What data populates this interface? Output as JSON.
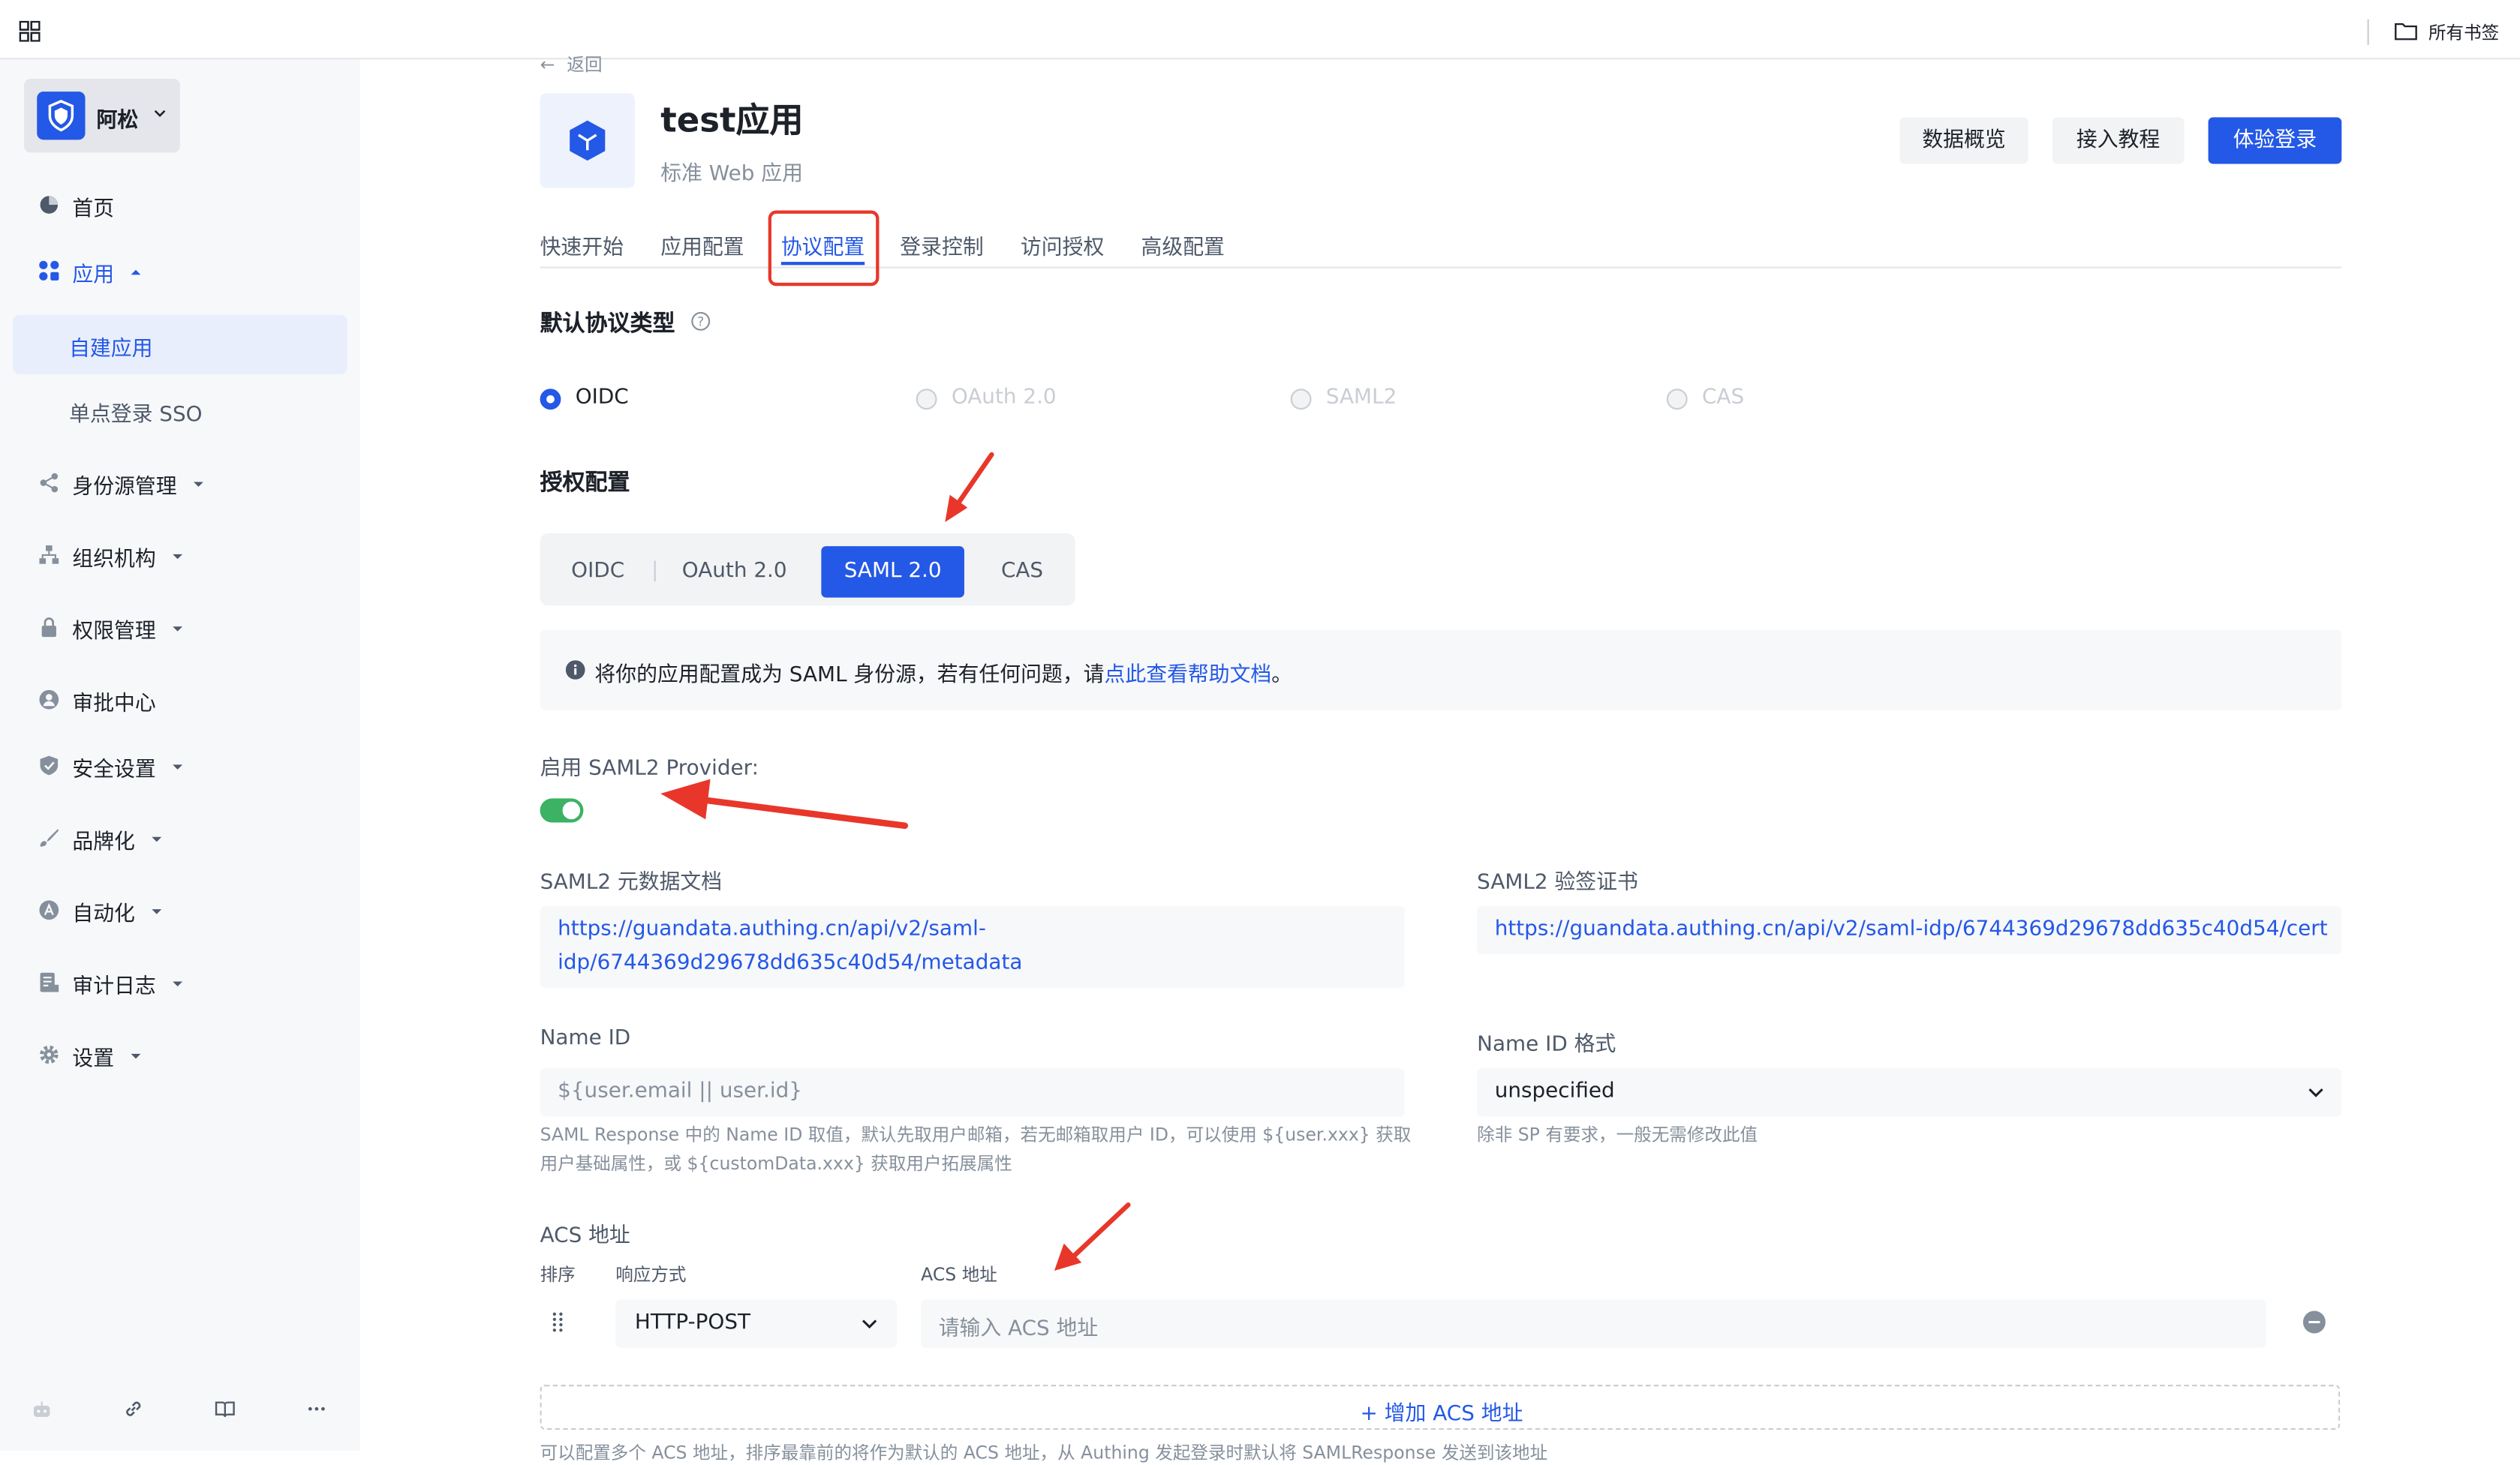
{
  "topbar": {
    "bookmarks_label": "所有书签"
  },
  "sidebar": {
    "org_name": "阿松",
    "nav": [
      {
        "label": "首页"
      },
      {
        "label": "应用"
      },
      {
        "label": "身份源管理"
      },
      {
        "label": "组织机构"
      },
      {
        "label": "权限管理"
      },
      {
        "label": "审批中心"
      },
      {
        "label": "安全设置"
      },
      {
        "label": "品牌化"
      },
      {
        "label": "自动化"
      },
      {
        "label": "审计日志"
      },
      {
        "label": "设置"
      }
    ],
    "app_sub": [
      {
        "label": "自建应用"
      },
      {
        "label": "单点登录 SSO"
      }
    ]
  },
  "header": {
    "back_label": "返回",
    "app_name": "test应用",
    "app_type": "标准 Web 应用",
    "btn_overview": "数据概览",
    "btn_tutorial": "接入教程",
    "btn_try_login": "体验登录"
  },
  "tabs": [
    {
      "label": "快速开始"
    },
    {
      "label": "应用配置"
    },
    {
      "label": "协议配置"
    },
    {
      "label": "登录控制"
    },
    {
      "label": "访问授权"
    },
    {
      "label": "高级配置"
    }
  ],
  "default_protocol": {
    "title": "默认协议类型",
    "options": [
      {
        "label": "OIDC",
        "selected": true
      },
      {
        "label": "OAuth 2.0",
        "selected": false
      },
      {
        "label": "SAML2",
        "selected": false
      },
      {
        "label": "CAS",
        "selected": false
      }
    ]
  },
  "auth_config": {
    "title": "授权配置",
    "segments": [
      {
        "label": "OIDC"
      },
      {
        "label": "OAuth 2.0"
      },
      {
        "label": "SAML 2.0"
      },
      {
        "label": "CAS"
      }
    ],
    "selected": "SAML 2.0"
  },
  "info": {
    "text": "将你的应用配置成为 SAML 身份源，若有任何问题，请",
    "link": "点此查看帮助文档",
    "suffix": "。"
  },
  "saml": {
    "enable_label": "启用 SAML2 Provider:",
    "enabled": true,
    "metadata_label": "SAML2 元数据文档",
    "metadata_line1": "https://guandata.authing.cn/api/v2/saml-",
    "metadata_line2": "idp/6744369d29678dd635c40d54/metadata",
    "cert_label": "SAML2 验签证书",
    "cert_url": "https://guandata.authing.cn/api/v2/saml-idp/6744369d29678dd635c40d54/cert",
    "nameid_label": "Name ID",
    "nameid_placeholder": "${user.email || user.id}",
    "nameid_hint1": "SAML Response 中的 Name ID 取值，默认先取用户邮箱，若无邮箱取用户 ID，可以使用 ${user.xxx} 获取",
    "nameid_hint2": "用户基础属性，或 ${customData.xxx} 获取用户拓展属性",
    "nameid_format_label": "Name ID 格式",
    "nameid_format_value": "unspecified",
    "nameid_format_hint": "除非 SP 有要求，一般无需修改此值"
  },
  "acs": {
    "title": "ACS 地址",
    "col_order": "排序",
    "col_method": "响应方式",
    "col_url": "ACS 地址",
    "method_value": "HTTP-POST",
    "url_placeholder": "请输入 ACS 地址",
    "add_label": "增加 ACS 地址",
    "footer_hint": "可以配置多个 ACS 地址，排序最靠前的将作为默认的 ACS 地址，从 Authing 发起登录时默认将 SAMLResponse 发送到该地址"
  },
  "colors": {
    "primary": "#2458e6",
    "toggle_on": "#3bb264",
    "annotation_red": "#e8372a"
  }
}
